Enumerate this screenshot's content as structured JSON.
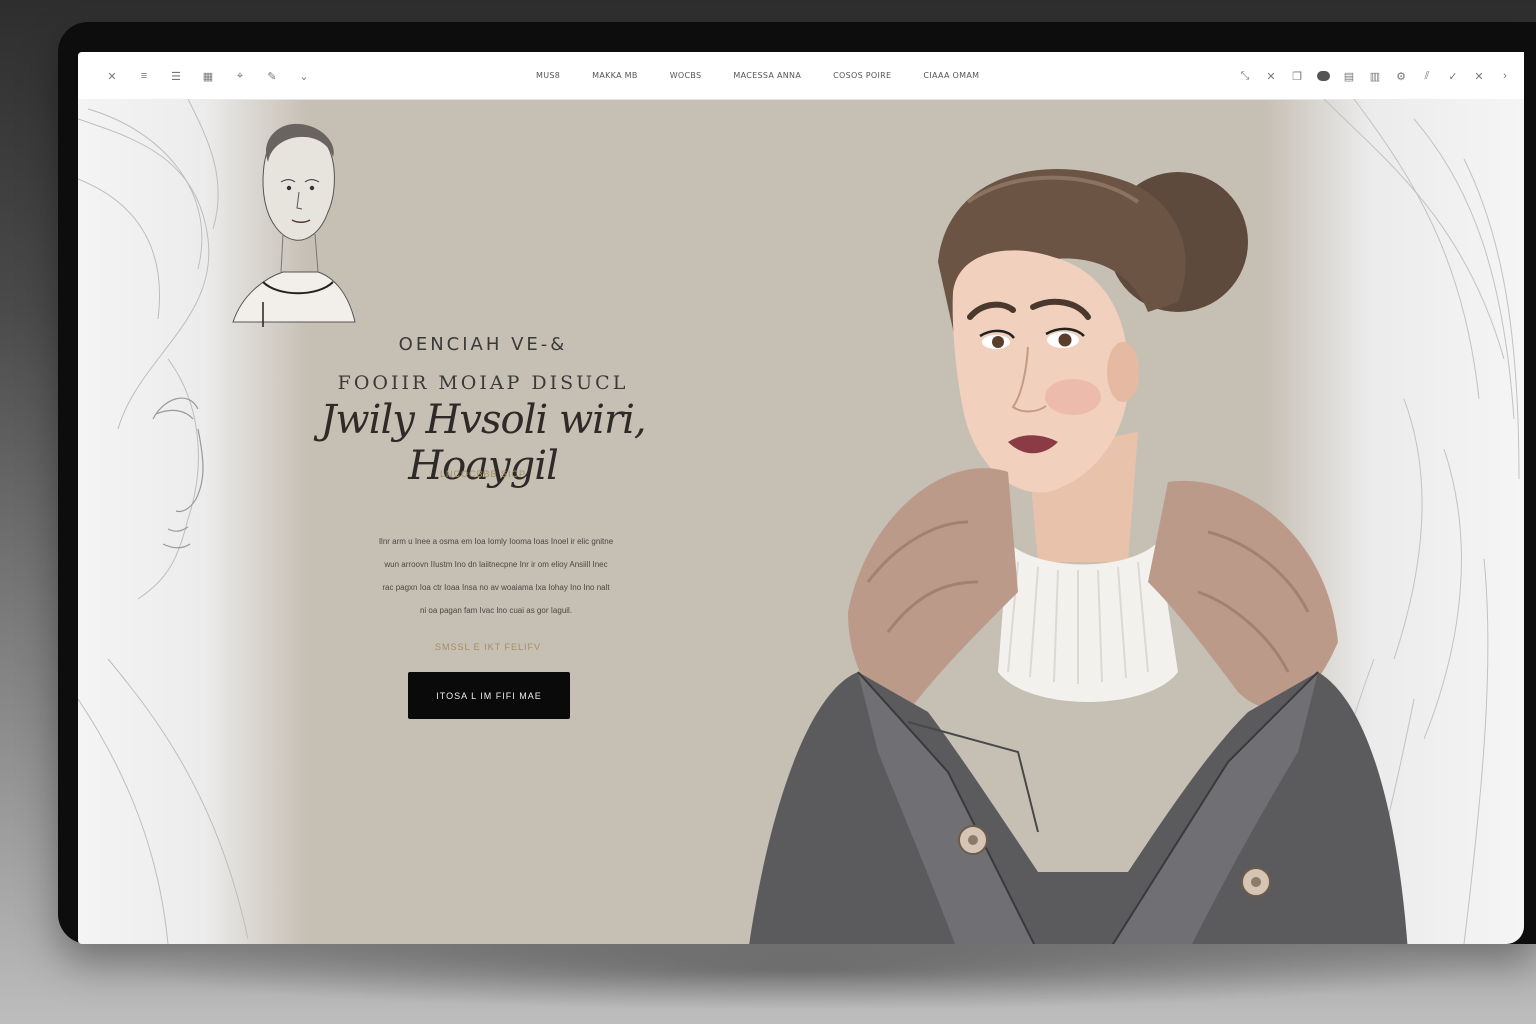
{
  "nav": {
    "left_icons": [
      "close-icon",
      "list-icon",
      "menu-icon",
      "grid-icon",
      "pin-icon",
      "edit-icon",
      "chevron-down-icon"
    ],
    "links": [
      "MUS8",
      "MAKKA MB",
      "WOCBS",
      "MACESSA ANNA",
      "COSOS POIRE",
      "CIAAA OMAM"
    ],
    "right_icons": [
      "expand-icon",
      "close-icon",
      "copy-icon",
      "user-icon",
      "table-icon",
      "bar-chart-icon",
      "settings-icon",
      "filter-icon",
      "check-icon",
      "close-icon",
      "chevron-right-icon"
    ]
  },
  "hero": {
    "eyebrow": "OENCIAH VE-&",
    "headline": "FOOIIR MOIAP DISUCL",
    "script_title": "Jwily Hvsoli wiri, Hoaygil",
    "kicker": "LNCOCBBB SICP",
    "body_lines": [
      "Ilnr arm u Inee a osma em Ioa Iomly Iooma Ioas Inoel ir elic gnitne",
      "wun arroovn IIustm Ino dn laiitnecpne Inr ir om elioy Ansiill Inec",
      "rac pagxn Ioa ctr Ioaa Insa no av woaiama Ixa Iohay Ino Ino nalt",
      "ni oa pagan fam Ivac lno cuai as gor Iaguil."
    ],
    "price": "SMSSL E IKT FELIFV",
    "cta_label": "ITOSA L IM  FIFI MAE"
  },
  "colors": {
    "hero_bg": "#c6bfb4",
    "accent_gold": "#a58f61",
    "cta_bg": "#0a0a0a"
  }
}
